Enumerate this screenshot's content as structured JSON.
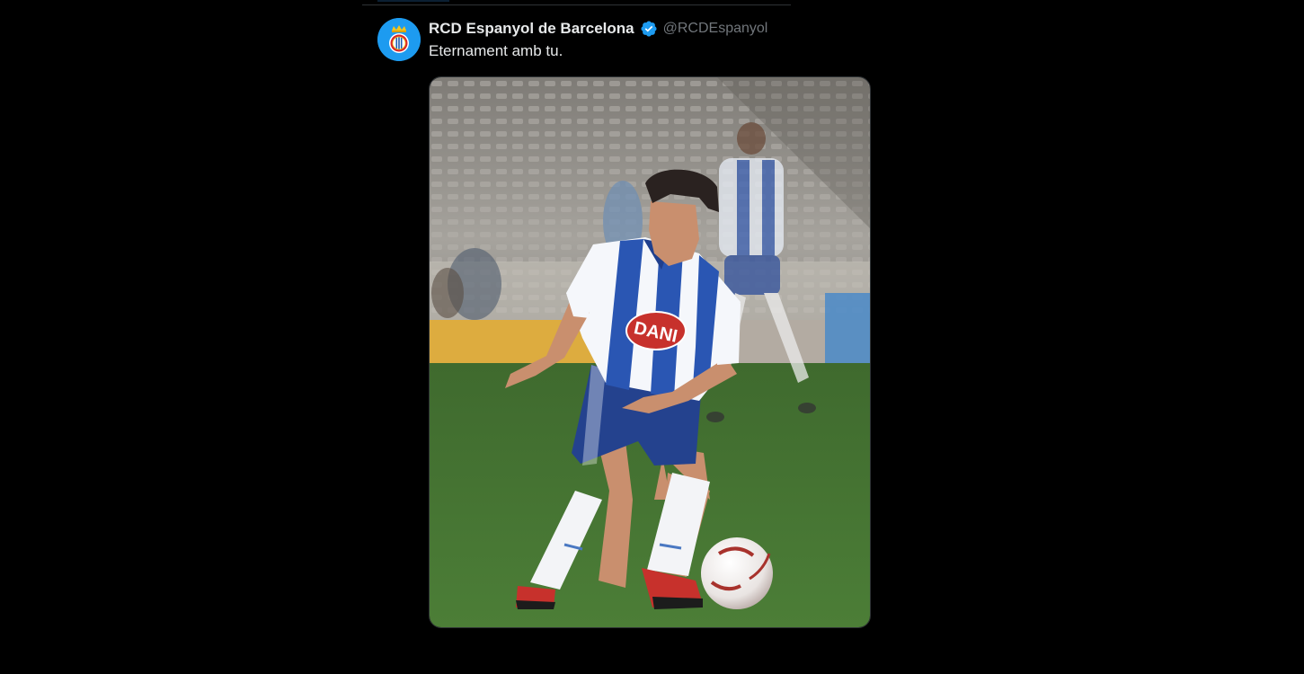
{
  "tweet": {
    "display_name": "RCD Espanyol de Barcelona",
    "handle": "@RCDEspanyol",
    "text": "Eternament amb tu.",
    "verified": true,
    "avatar_icon": "espanyol-crest-icon",
    "verified_icon": "verified-badge-icon",
    "media": {
      "type": "photo",
      "sponsor_text": "DANI"
    }
  },
  "colors": {
    "background": "#000000",
    "text_primary": "#e7e9ea",
    "text_secondary": "#71767b",
    "accent": "#1d9bf0",
    "divider": "#2f3336"
  }
}
